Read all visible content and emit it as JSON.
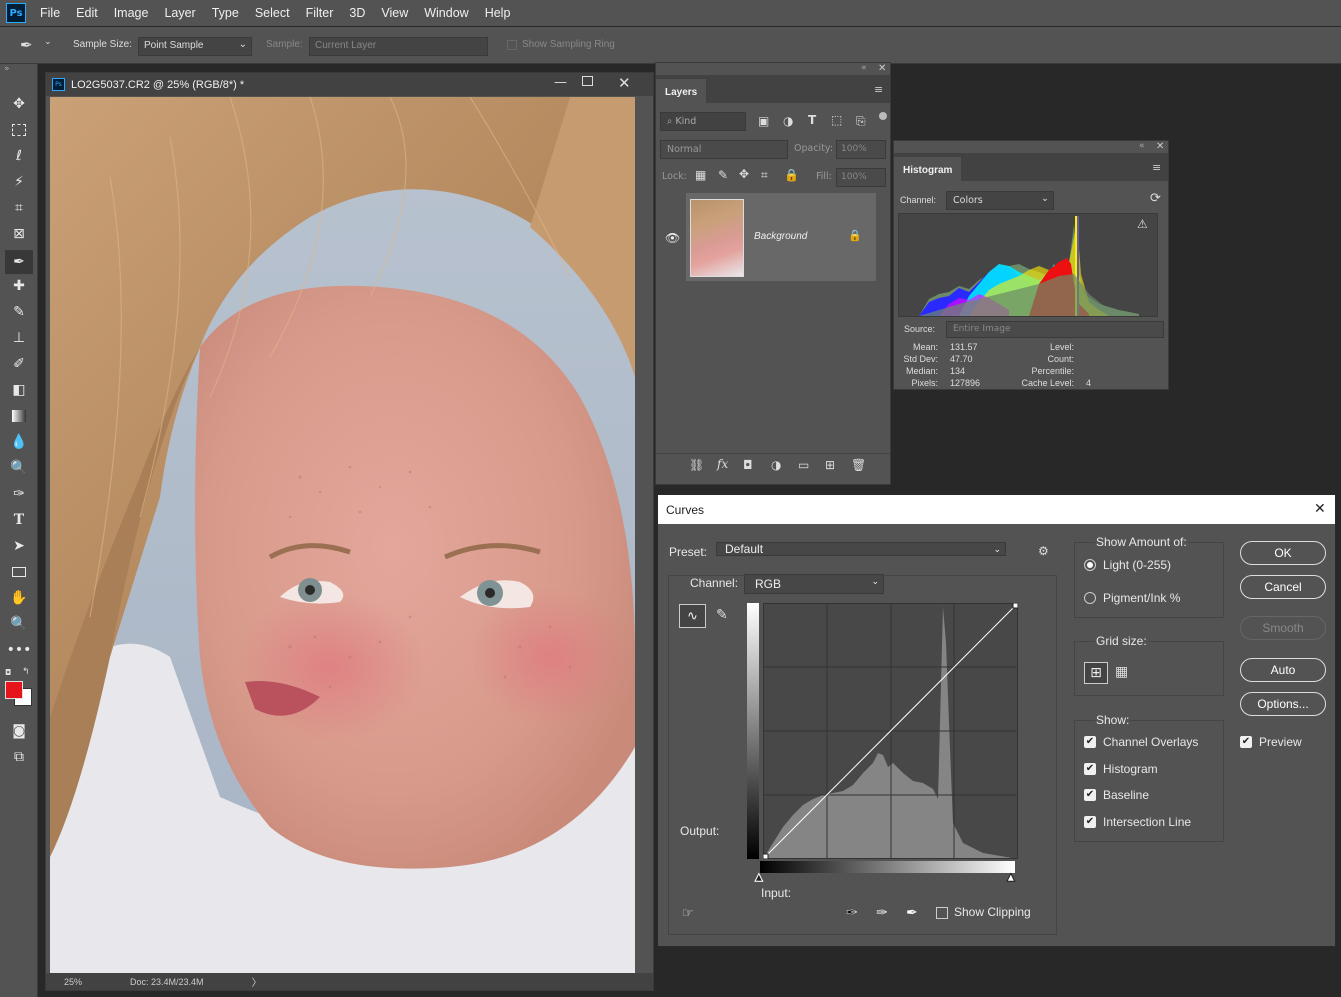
{
  "app": {
    "logo": "Ps",
    "menus": [
      "File",
      "Edit",
      "Image",
      "Layer",
      "Type",
      "Select",
      "Filter",
      "3D",
      "View",
      "Window",
      "Help"
    ]
  },
  "options": {
    "sample_size_label": "Sample Size:",
    "sample_size_value": "Point Sample",
    "sample_label": "Sample:",
    "sample_value": "Current Layer",
    "show_ring": "Show Sampling Ring"
  },
  "document": {
    "title": "LO2G5037.CR2 @ 25% (RGB/8*) *",
    "zoom": "25%",
    "doc_size": "Doc: 23.4M/23.4M"
  },
  "layers": {
    "tab": "Layers",
    "filter_kind": "Kind",
    "blend_mode": "Normal",
    "opacity_label": "Opacity:",
    "opacity": "100%",
    "lock_label": "Lock:",
    "fill_label": "Fill:",
    "fill": "100%",
    "layer_name": "Background"
  },
  "histogram": {
    "tab": "Histogram",
    "channel_label": "Channel:",
    "channel": "Colors",
    "source_label": "Source:",
    "source": "Entire Image",
    "mean_label": "Mean:",
    "mean": "131.57",
    "stddev_label": "Std Dev:",
    "stddev": "47.70",
    "median_label": "Median:",
    "median": "134",
    "pixels_label": "Pixels:",
    "pixels": "127896",
    "level_label": "Level:",
    "count_label": "Count:",
    "percentile_label": "Percentile:",
    "cache_label": "Cache Level:",
    "cache": "4"
  },
  "curves": {
    "title": "Curves",
    "preset_label": "Preset:",
    "preset": "Default",
    "channel_label": "Channel:",
    "channel": "RGB",
    "output_label": "Output:",
    "input_label": "Input:",
    "show_clipping": "Show Clipping",
    "show_amount_label": "Show Amount of:",
    "light": "Light  (0-255)",
    "pigment": "Pigment/Ink %",
    "grid_size_label": "Grid size:",
    "show_label": "Show:",
    "show_items": [
      "Channel Overlays",
      "Histogram",
      "Baseline",
      "Intersection Line"
    ],
    "preview": "Preview",
    "buttons": {
      "ok": "OK",
      "cancel": "Cancel",
      "smooth": "Smooth",
      "auto": "Auto",
      "options": "Options..."
    }
  }
}
